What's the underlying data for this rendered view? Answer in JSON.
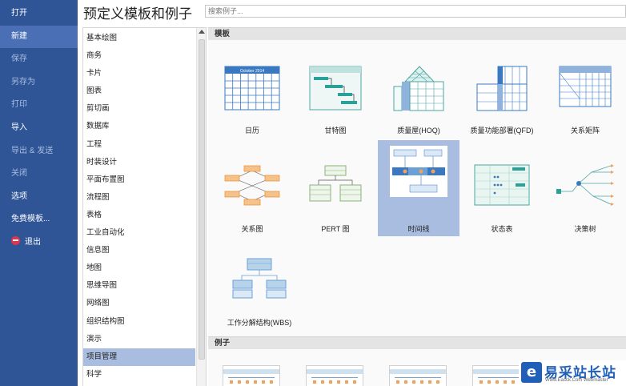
{
  "nav": {
    "items": [
      {
        "label": "打开"
      },
      {
        "label": "新建"
      },
      {
        "label": "保存"
      },
      {
        "label": "另存为"
      },
      {
        "label": "打印"
      },
      {
        "label": "导入"
      },
      {
        "label": "导出 & 发送"
      },
      {
        "label": "关闭"
      },
      {
        "label": "选项"
      },
      {
        "label": "免费模板..."
      },
      {
        "label": "退出"
      }
    ]
  },
  "header": {
    "title": "预定义模板和例子",
    "search_placeholder": "搜索例子..."
  },
  "categories": [
    {
      "label": "基本绘图"
    },
    {
      "label": "商务"
    },
    {
      "label": "卡片"
    },
    {
      "label": "图表"
    },
    {
      "label": "剪切画"
    },
    {
      "label": "数据库"
    },
    {
      "label": "工程"
    },
    {
      "label": "时装设计"
    },
    {
      "label": "平面布置图"
    },
    {
      "label": "流程图"
    },
    {
      "label": "表格"
    },
    {
      "label": "工业自动化"
    },
    {
      "label": "信息图"
    },
    {
      "label": "地图"
    },
    {
      "label": "思维导图"
    },
    {
      "label": "网络图"
    },
    {
      "label": "组织结构图"
    },
    {
      "label": "演示"
    },
    {
      "label": "项目管理"
    },
    {
      "label": "科学"
    }
  ],
  "selected_category": "项目管理",
  "sections": {
    "templates_label": "模板",
    "examples_label": "例子"
  },
  "templates": [
    {
      "label": "日历",
      "icon": "calendar-icon",
      "calendar_header": "October 2014"
    },
    {
      "label": "甘特图",
      "icon": "gantt-icon"
    },
    {
      "label": "质量屋(HOQ)",
      "icon": "house-of-quality-icon"
    },
    {
      "label": "质量功能部署(QFD)",
      "icon": "qfd-icon"
    },
    {
      "label": "关系矩阵",
      "icon": "relation-matrix-icon"
    },
    {
      "label": "关系图",
      "icon": "relationship-diagram-icon"
    },
    {
      "label": "PERT 图",
      "icon": "pert-chart-icon"
    },
    {
      "label": "时间线",
      "icon": "timeline-icon"
    },
    {
      "label": "状态表",
      "icon": "status-table-icon"
    },
    {
      "label": "决策树",
      "icon": "decision-tree-icon"
    },
    {
      "label": "工作分解结构(WBS)",
      "icon": "wbs-icon"
    }
  ],
  "selected_template": "时间线",
  "watermark": {
    "logo_glyph": "e",
    "text": "易采站长站",
    "sub": "Www.Easck.Com  Webmaster"
  },
  "colors": {
    "nav_bg": "#2f5597",
    "nav_active": "#4a6fb5",
    "selection": "#a9bde0",
    "accent_teal": "#2aa198",
    "accent_blue": "#3a78c2"
  }
}
